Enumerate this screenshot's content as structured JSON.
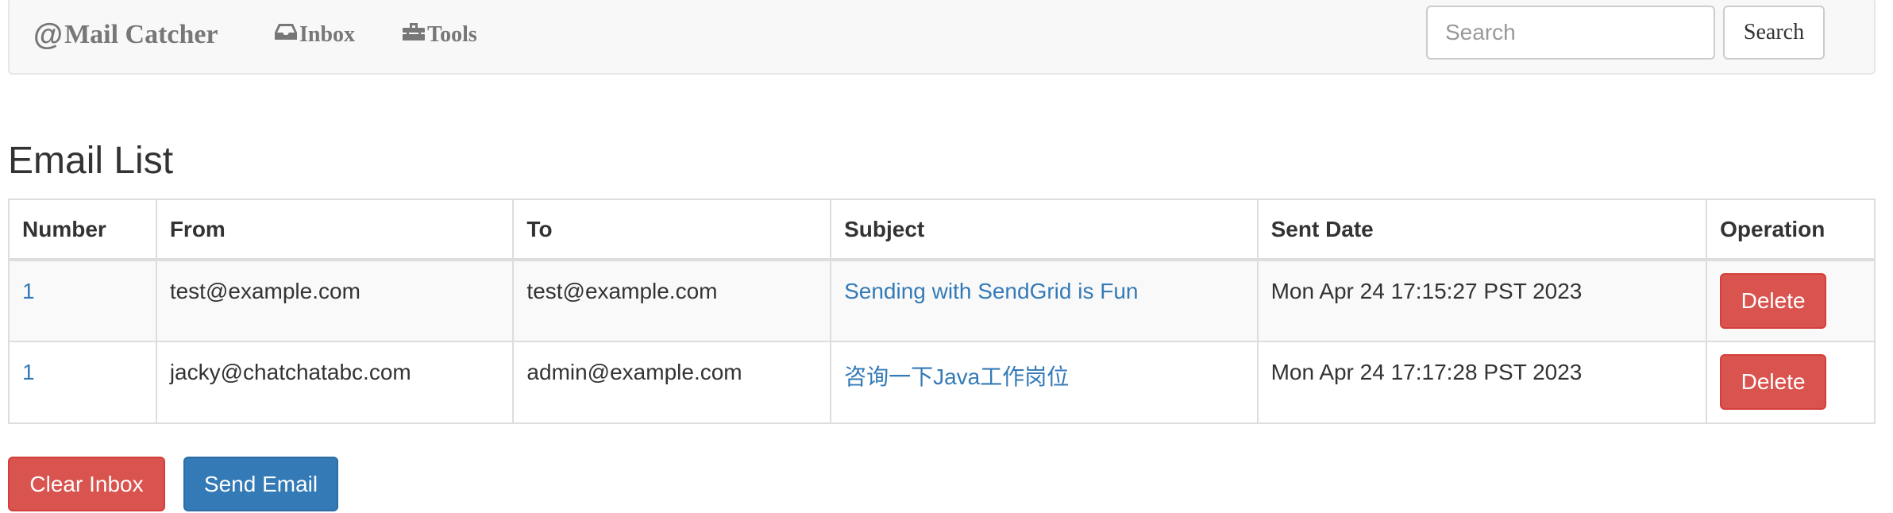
{
  "navbar": {
    "brand": "Mail Catcher",
    "brand_prefix": "@",
    "links": [
      {
        "label": "Inbox",
        "icon": "inbox-icon"
      },
      {
        "label": "Tools",
        "icon": "toolbox-icon"
      }
    ],
    "search_placeholder": "Search",
    "search_value": "",
    "search_button": "Search"
  },
  "page": {
    "title": "Email List"
  },
  "table": {
    "headers": [
      "Number",
      "From",
      "To",
      "Subject",
      "Sent Date",
      "Operation"
    ],
    "rows": [
      {
        "number": "1",
        "from": "test@example.com",
        "to": "test@example.com",
        "subject": "Sending with SendGrid is Fun",
        "sent_date": "Mon Apr 24 17:15:27 PST 2023",
        "operation": "Delete"
      },
      {
        "number": "1",
        "from": "jacky@chatchatabc.com",
        "to": "admin@example.com",
        "subject": "咨询一下Java工作岗位",
        "sent_date": "Mon Apr 24 17:17:28 PST 2023",
        "operation": "Delete"
      }
    ]
  },
  "actions": {
    "clear_inbox": "Clear Inbox",
    "send_email": "Send Email"
  },
  "colors": {
    "link": "#337ab7",
    "danger": "#d9534f",
    "primary": "#337ab7",
    "navbar_bg": "#f8f8f8",
    "navbar_text": "#777777"
  }
}
